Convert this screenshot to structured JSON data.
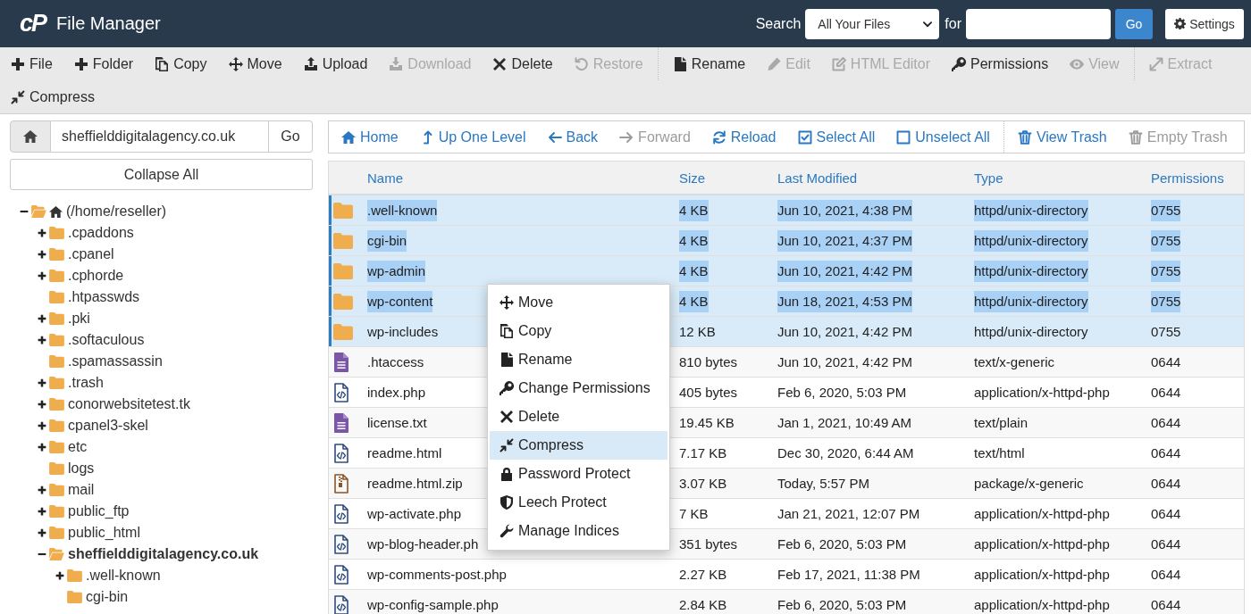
{
  "header": {
    "logo": "cP",
    "title": "File Manager",
    "search_label": "Search",
    "search_scope": "All Your Files",
    "for_label": "for",
    "go": "Go",
    "settings": "Settings"
  },
  "toolbar": [
    {
      "items": [
        {
          "label": "File",
          "disabled": false
        },
        {
          "label": "Folder",
          "disabled": false
        },
        {
          "label": "Copy",
          "disabled": false
        },
        {
          "label": "Move",
          "disabled": false
        },
        {
          "label": "Upload",
          "disabled": false
        },
        {
          "label": "Download",
          "disabled": true
        },
        {
          "label": "Delete",
          "disabled": false
        },
        {
          "label": "Restore",
          "disabled": true
        }
      ]
    },
    {
      "items": [
        {
          "label": "Rename",
          "disabled": false
        },
        {
          "label": "Edit",
          "disabled": true
        },
        {
          "label": "HTML Editor",
          "disabled": true
        },
        {
          "label": "Permissions",
          "disabled": false
        },
        {
          "label": "View",
          "disabled": true
        }
      ]
    },
    {
      "items": [
        {
          "label": "Extract",
          "disabled": true
        },
        {
          "label": "Compress",
          "disabled": false
        }
      ]
    }
  ],
  "path_bar": {
    "value": "sheffielddigitalagency.co.uk",
    "go": "Go"
  },
  "collapse_all": "Collapse All",
  "tree": {
    "label": "(/home/reseller)",
    "kind": "branch",
    "expanded": true,
    "selected": false,
    "children": [
      {
        "label": ".cpaddons",
        "kind": "branch",
        "expanded": false,
        "selected": false
      },
      {
        "label": ".cpanel",
        "kind": "branch",
        "expanded": false,
        "selected": false
      },
      {
        "label": ".cphorde",
        "kind": "branch",
        "expanded": false,
        "selected": false
      },
      {
        "label": ".htpasswds",
        "kind": "leaf",
        "expanded": false,
        "selected": false
      },
      {
        "label": ".pki",
        "kind": "branch",
        "expanded": false,
        "selected": false
      },
      {
        "label": ".softaculous",
        "kind": "branch",
        "expanded": false,
        "selected": false
      },
      {
        "label": ".spamassassin",
        "kind": "leaf",
        "expanded": false,
        "selected": false
      },
      {
        "label": ".trash",
        "kind": "branch",
        "expanded": false,
        "selected": false
      },
      {
        "label": "conorwebsitetest.tk",
        "kind": "branch",
        "expanded": false,
        "selected": false
      },
      {
        "label": "cpanel3-skel",
        "kind": "branch",
        "expanded": false,
        "selected": false
      },
      {
        "label": "etc",
        "kind": "branch",
        "expanded": false,
        "selected": false
      },
      {
        "label": "logs",
        "kind": "leaf",
        "expanded": false,
        "selected": false
      },
      {
        "label": "mail",
        "kind": "branch",
        "expanded": false,
        "selected": false
      },
      {
        "label": "public_ftp",
        "kind": "branch",
        "expanded": false,
        "selected": false
      },
      {
        "label": "public_html",
        "kind": "branch",
        "expanded": false,
        "selected": false
      },
      {
        "label": "sheffielddigitalagency.co.uk",
        "kind": "branch",
        "expanded": true,
        "selected": true,
        "children": [
          {
            "label": ".well-known",
            "kind": "branch",
            "expanded": false,
            "selected": false
          },
          {
            "label": "cgi-bin",
            "kind": "leaf",
            "expanded": false,
            "selected": false
          }
        ]
      }
    ]
  },
  "nav": [
    {
      "items": [
        {
          "label": "Home",
          "disabled": false
        },
        {
          "label": "Up One Level",
          "disabled": false
        },
        {
          "label": "Back",
          "disabled": false
        },
        {
          "label": "Forward",
          "disabled": true
        },
        {
          "label": "Reload",
          "disabled": false
        },
        {
          "label": "Select All",
          "disabled": false
        },
        {
          "label": "Unselect All",
          "disabled": false
        }
      ]
    },
    {
      "items": [
        {
          "label": "View Trash",
          "disabled": false
        },
        {
          "label": "Empty Trash",
          "disabled": true
        }
      ]
    }
  ],
  "table": {
    "columns": [
      "Name",
      "Size",
      "Last Modified",
      "Type",
      "Permissions"
    ],
    "rows": [
      {
        "kind": "folder",
        "name": ".well-known",
        "size": "4 KB",
        "modified": "Jun 10, 2021, 4:38 PM",
        "type": "httpd/unix-directory",
        "permissions": "0755",
        "selected": true,
        "text_selected": true
      },
      {
        "kind": "folder",
        "name": "cgi-bin",
        "size": "4 KB",
        "modified": "Jun 10, 2021, 4:37 PM",
        "type": "httpd/unix-directory",
        "permissions": "0755",
        "selected": true,
        "text_selected": true
      },
      {
        "kind": "folder",
        "name": "wp-admin",
        "size": "4 KB",
        "modified": "Jun 10, 2021, 4:42 PM",
        "type": "httpd/unix-directory",
        "permissions": "0755",
        "selected": true,
        "text_selected": true
      },
      {
        "kind": "folder",
        "name": "wp-content",
        "size": "4 KB",
        "modified": "Jun 18, 2021, 4:53 PM",
        "type": "httpd/unix-directory",
        "permissions": "0755",
        "selected": true,
        "text_selected": true
      },
      {
        "kind": "folder",
        "name": "wp-includes",
        "size": "12 KB",
        "modified": "Jun 10, 2021, 4:42 PM",
        "type": "httpd/unix-directory",
        "permissions": "0755",
        "selected": true,
        "text_selected": false
      },
      {
        "kind": "text",
        "name": ".htaccess",
        "size": "810 bytes",
        "modified": "Jun 10, 2021, 4:42 PM",
        "type": "text/x-generic",
        "permissions": "0644",
        "selected": false,
        "text_selected": false
      },
      {
        "kind": "code",
        "name": "index.php",
        "size": "405 bytes",
        "modified": "Feb 6, 2020, 5:03 PM",
        "type": "application/x-httpd-php",
        "permissions": "0644",
        "selected": false,
        "text_selected": false
      },
      {
        "kind": "text",
        "name": "license.txt",
        "size": "19.45 KB",
        "modified": "Jan 1, 2021, 10:49 AM",
        "type": "text/plain",
        "permissions": "0644",
        "selected": false,
        "text_selected": false
      },
      {
        "kind": "code",
        "name": "readme.html",
        "size": "7.17 KB",
        "modified": "Dec 30, 2020, 6:44 AM",
        "type": "text/html",
        "permissions": "0644",
        "selected": false,
        "text_selected": false
      },
      {
        "kind": "archive",
        "name": "readme.html.zip",
        "size": "3.07 KB",
        "modified": "Today, 5:57 PM",
        "type": "package/x-generic",
        "permissions": "0644",
        "selected": false,
        "text_selected": false
      },
      {
        "kind": "code",
        "name": "wp-activate.php",
        "size": "7 KB",
        "modified": "Jan 21, 2021, 12:07 PM",
        "type": "application/x-httpd-php",
        "permissions": "0644",
        "selected": false,
        "text_selected": false
      },
      {
        "kind": "code",
        "name": "wp-blog-header.ph",
        "size": "351 bytes",
        "modified": "Feb 6, 2020, 5:03 PM",
        "type": "application/x-httpd-php",
        "permissions": "0644",
        "selected": false,
        "text_selected": false
      },
      {
        "kind": "code",
        "name": "wp-comments-post.php",
        "size": "2.27 KB",
        "modified": "Feb 17, 2021, 11:38 PM",
        "type": "application/x-httpd-php",
        "permissions": "0644",
        "selected": false,
        "text_selected": false
      },
      {
        "kind": "code",
        "name": "wp-config-sample.php",
        "size": "2.84 KB",
        "modified": "Feb 6, 2020, 5:03 PM",
        "type": "application/x-httpd-php",
        "permissions": "0644",
        "selected": false,
        "text_selected": false
      }
    ]
  },
  "context_menu": [
    {
      "label": "Move",
      "selected": false
    },
    {
      "label": "Copy",
      "selected": false
    },
    {
      "label": "Rename",
      "selected": false
    },
    {
      "label": "Change Permissions",
      "selected": false
    },
    {
      "label": "Delete",
      "selected": false
    },
    {
      "label": "Compress",
      "selected": true
    },
    {
      "label": "Password Protect",
      "selected": false
    },
    {
      "label": "Leech Protect",
      "selected": false
    },
    {
      "label": "Manage Indices",
      "selected": false
    }
  ]
}
